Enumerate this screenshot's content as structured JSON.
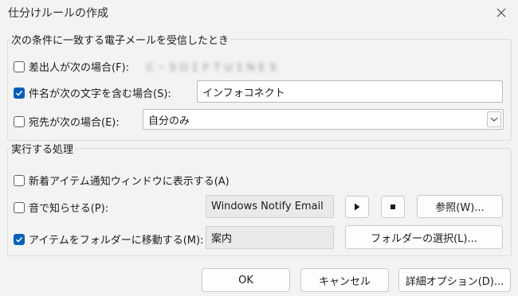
{
  "window": {
    "title": "仕分けルールの作成",
    "close_icon": "close-icon"
  },
  "conditions": {
    "group_label": "次の条件に一致する電子メールを受信したとき",
    "from": {
      "label": "差出人が次の場合(F):",
      "checked": false,
      "value": "Ｃ・ＳＯＩＦＴＵＩＮＥＳ"
    },
    "subject": {
      "label": "件名が次の文字を含む場合(S):",
      "checked": true,
      "value": "インフォコネクト"
    },
    "to": {
      "label": "宛先が次の場合(E):",
      "checked": false,
      "selected": "自分のみ"
    }
  },
  "actions": {
    "group_label": "実行する処理",
    "alert": {
      "label": "新着アイテム通知ウィンドウに表示する(A)",
      "checked": false
    },
    "sound": {
      "label": "音で知らせる(P):",
      "checked": false,
      "value": "Windows Notify Email",
      "browse_label": "参照(W)..."
    },
    "move": {
      "label": "アイテムをフォルダーに移動する(M):",
      "checked": true,
      "value": "案内",
      "select_folder_label": "フォルダーの選択(L)..."
    }
  },
  "footer": {
    "ok_label": "OK",
    "cancel_label": "キャンセル",
    "advanced_label": "詳細オプション(D)..."
  },
  "colors": {
    "accent": "#005fb8",
    "background": "#f3f3f3"
  }
}
